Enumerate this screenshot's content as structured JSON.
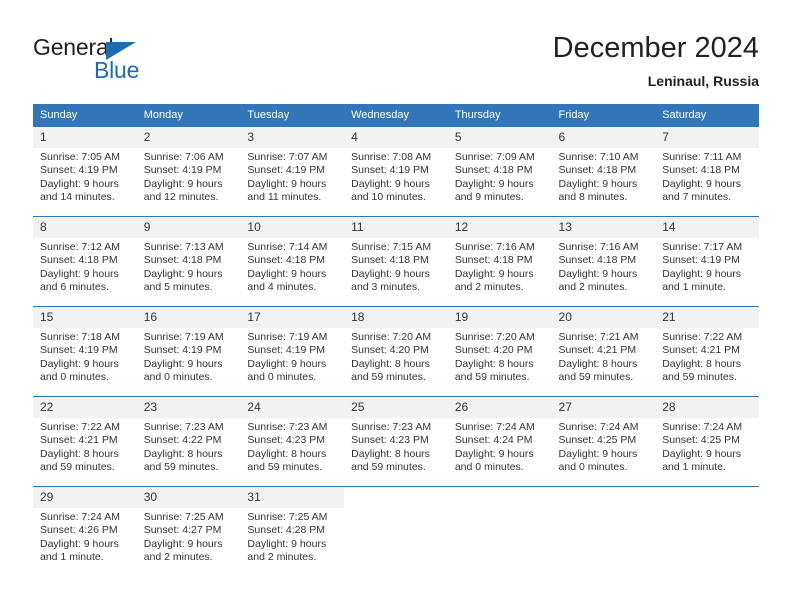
{
  "brand": {
    "name_part1": "General",
    "name_part2": "Blue",
    "triangle_icon": "triangle-icon"
  },
  "header": {
    "title": "December 2024",
    "subtitle": "Leninaul, Russia"
  },
  "calendar": {
    "weekdays": [
      "Sunday",
      "Monday",
      "Tuesday",
      "Wednesday",
      "Thursday",
      "Friday",
      "Saturday"
    ],
    "accent_color": "#3275b8",
    "daynum_background": "#f2f2f2",
    "weeks": [
      [
        {
          "day": "1",
          "sunrise": "Sunrise: 7:05 AM",
          "sunset": "Sunset: 4:19 PM",
          "daylight_line1": "Daylight: 9 hours",
          "daylight_line2": "and 14 minutes."
        },
        {
          "day": "2",
          "sunrise": "Sunrise: 7:06 AM",
          "sunset": "Sunset: 4:19 PM",
          "daylight_line1": "Daylight: 9 hours",
          "daylight_line2": "and 12 minutes."
        },
        {
          "day": "3",
          "sunrise": "Sunrise: 7:07 AM",
          "sunset": "Sunset: 4:19 PM",
          "daylight_line1": "Daylight: 9 hours",
          "daylight_line2": "and 11 minutes."
        },
        {
          "day": "4",
          "sunrise": "Sunrise: 7:08 AM",
          "sunset": "Sunset: 4:19 PM",
          "daylight_line1": "Daylight: 9 hours",
          "daylight_line2": "and 10 minutes."
        },
        {
          "day": "5",
          "sunrise": "Sunrise: 7:09 AM",
          "sunset": "Sunset: 4:18 PM",
          "daylight_line1": "Daylight: 9 hours",
          "daylight_line2": "and 9 minutes."
        },
        {
          "day": "6",
          "sunrise": "Sunrise: 7:10 AM",
          "sunset": "Sunset: 4:18 PM",
          "daylight_line1": "Daylight: 9 hours",
          "daylight_line2": "and 8 minutes."
        },
        {
          "day": "7",
          "sunrise": "Sunrise: 7:11 AM",
          "sunset": "Sunset: 4:18 PM",
          "daylight_line1": "Daylight: 9 hours",
          "daylight_line2": "and 7 minutes."
        }
      ],
      [
        {
          "day": "8",
          "sunrise": "Sunrise: 7:12 AM",
          "sunset": "Sunset: 4:18 PM",
          "daylight_line1": "Daylight: 9 hours",
          "daylight_line2": "and 6 minutes."
        },
        {
          "day": "9",
          "sunrise": "Sunrise: 7:13 AM",
          "sunset": "Sunset: 4:18 PM",
          "daylight_line1": "Daylight: 9 hours",
          "daylight_line2": "and 5 minutes."
        },
        {
          "day": "10",
          "sunrise": "Sunrise: 7:14 AM",
          "sunset": "Sunset: 4:18 PM",
          "daylight_line1": "Daylight: 9 hours",
          "daylight_line2": "and 4 minutes."
        },
        {
          "day": "11",
          "sunrise": "Sunrise: 7:15 AM",
          "sunset": "Sunset: 4:18 PM",
          "daylight_line1": "Daylight: 9 hours",
          "daylight_line2": "and 3 minutes."
        },
        {
          "day": "12",
          "sunrise": "Sunrise: 7:16 AM",
          "sunset": "Sunset: 4:18 PM",
          "daylight_line1": "Daylight: 9 hours",
          "daylight_line2": "and 2 minutes."
        },
        {
          "day": "13",
          "sunrise": "Sunrise: 7:16 AM",
          "sunset": "Sunset: 4:18 PM",
          "daylight_line1": "Daylight: 9 hours",
          "daylight_line2": "and 2 minutes."
        },
        {
          "day": "14",
          "sunrise": "Sunrise: 7:17 AM",
          "sunset": "Sunset: 4:19 PM",
          "daylight_line1": "Daylight: 9 hours",
          "daylight_line2": "and 1 minute."
        }
      ],
      [
        {
          "day": "15",
          "sunrise": "Sunrise: 7:18 AM",
          "sunset": "Sunset: 4:19 PM",
          "daylight_line1": "Daylight: 9 hours",
          "daylight_line2": "and 0 minutes."
        },
        {
          "day": "16",
          "sunrise": "Sunrise: 7:19 AM",
          "sunset": "Sunset: 4:19 PM",
          "daylight_line1": "Daylight: 9 hours",
          "daylight_line2": "and 0 minutes."
        },
        {
          "day": "17",
          "sunrise": "Sunrise: 7:19 AM",
          "sunset": "Sunset: 4:19 PM",
          "daylight_line1": "Daylight: 9 hours",
          "daylight_line2": "and 0 minutes."
        },
        {
          "day": "18",
          "sunrise": "Sunrise: 7:20 AM",
          "sunset": "Sunset: 4:20 PM",
          "daylight_line1": "Daylight: 8 hours",
          "daylight_line2": "and 59 minutes."
        },
        {
          "day": "19",
          "sunrise": "Sunrise: 7:20 AM",
          "sunset": "Sunset: 4:20 PM",
          "daylight_line1": "Daylight: 8 hours",
          "daylight_line2": "and 59 minutes."
        },
        {
          "day": "20",
          "sunrise": "Sunrise: 7:21 AM",
          "sunset": "Sunset: 4:21 PM",
          "daylight_line1": "Daylight: 8 hours",
          "daylight_line2": "and 59 minutes."
        },
        {
          "day": "21",
          "sunrise": "Sunrise: 7:22 AM",
          "sunset": "Sunset: 4:21 PM",
          "daylight_line1": "Daylight: 8 hours",
          "daylight_line2": "and 59 minutes."
        }
      ],
      [
        {
          "day": "22",
          "sunrise": "Sunrise: 7:22 AM",
          "sunset": "Sunset: 4:21 PM",
          "daylight_line1": "Daylight: 8 hours",
          "daylight_line2": "and 59 minutes."
        },
        {
          "day": "23",
          "sunrise": "Sunrise: 7:23 AM",
          "sunset": "Sunset: 4:22 PM",
          "daylight_line1": "Daylight: 8 hours",
          "daylight_line2": "and 59 minutes."
        },
        {
          "day": "24",
          "sunrise": "Sunrise: 7:23 AM",
          "sunset": "Sunset: 4:23 PM",
          "daylight_line1": "Daylight: 8 hours",
          "daylight_line2": "and 59 minutes."
        },
        {
          "day": "25",
          "sunrise": "Sunrise: 7:23 AM",
          "sunset": "Sunset: 4:23 PM",
          "daylight_line1": "Daylight: 8 hours",
          "daylight_line2": "and 59 minutes."
        },
        {
          "day": "26",
          "sunrise": "Sunrise: 7:24 AM",
          "sunset": "Sunset: 4:24 PM",
          "daylight_line1": "Daylight: 9 hours",
          "daylight_line2": "and 0 minutes."
        },
        {
          "day": "27",
          "sunrise": "Sunrise: 7:24 AM",
          "sunset": "Sunset: 4:25 PM",
          "daylight_line1": "Daylight: 9 hours",
          "daylight_line2": "and 0 minutes."
        },
        {
          "day": "28",
          "sunrise": "Sunrise: 7:24 AM",
          "sunset": "Sunset: 4:25 PM",
          "daylight_line1": "Daylight: 9 hours",
          "daylight_line2": "and 1 minute."
        }
      ],
      [
        {
          "day": "29",
          "sunrise": "Sunrise: 7:24 AM",
          "sunset": "Sunset: 4:26 PM",
          "daylight_line1": "Daylight: 9 hours",
          "daylight_line2": "and 1 minute."
        },
        {
          "day": "30",
          "sunrise": "Sunrise: 7:25 AM",
          "sunset": "Sunset: 4:27 PM",
          "daylight_line1": "Daylight: 9 hours",
          "daylight_line2": "and 2 minutes."
        },
        {
          "day": "31",
          "sunrise": "Sunrise: 7:25 AM",
          "sunset": "Sunset: 4:28 PM",
          "daylight_line1": "Daylight: 9 hours",
          "daylight_line2": "and 2 minutes."
        },
        {
          "day": "",
          "sunrise": "",
          "sunset": "",
          "daylight_line1": "",
          "daylight_line2": ""
        },
        {
          "day": "",
          "sunrise": "",
          "sunset": "",
          "daylight_line1": "",
          "daylight_line2": ""
        },
        {
          "day": "",
          "sunrise": "",
          "sunset": "",
          "daylight_line1": "",
          "daylight_line2": ""
        },
        {
          "day": "",
          "sunrise": "",
          "sunset": "",
          "daylight_line1": "",
          "daylight_line2": ""
        }
      ]
    ]
  }
}
